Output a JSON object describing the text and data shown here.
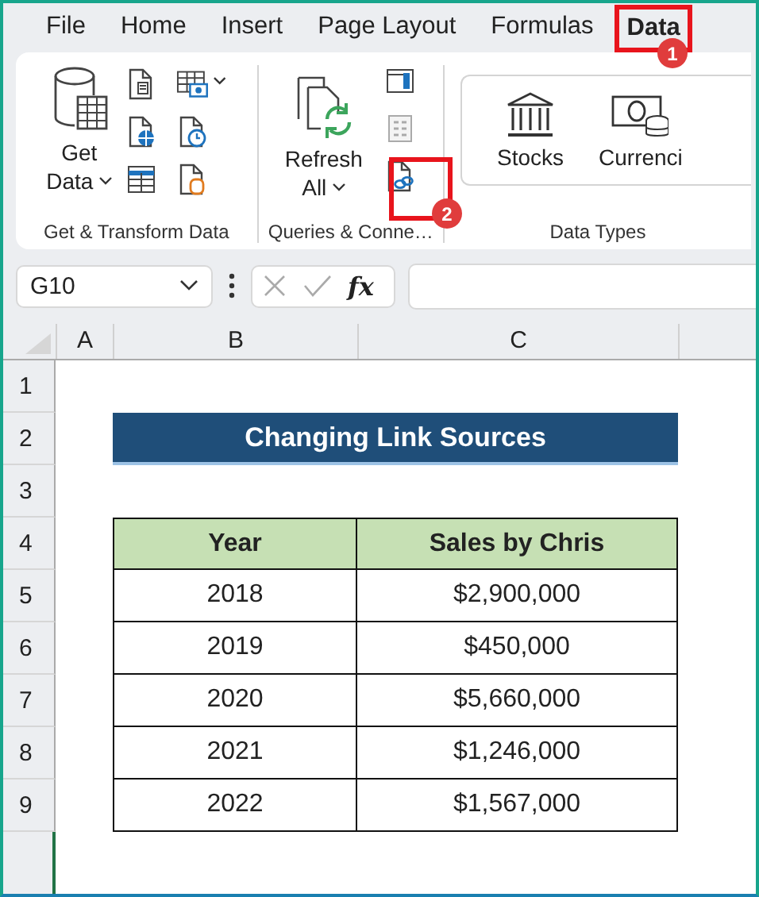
{
  "menu_tabs": [
    {
      "label": "File",
      "selected": false
    },
    {
      "label": "Home",
      "selected": false
    },
    {
      "label": "Insert",
      "selected": false
    },
    {
      "label": "Page Layout",
      "selected": false
    },
    {
      "label": "Formulas",
      "selected": false
    },
    {
      "label": "Data",
      "selected": true
    }
  ],
  "ribbon": {
    "groups": [
      {
        "label": "Get & Transform Data",
        "large_button": [
          "Get",
          "Data"
        ]
      },
      {
        "label": "Queries & Conne…",
        "large_button": [
          "Refresh",
          "All"
        ]
      },
      {
        "label": "Data Types",
        "type_buttons": [
          "Stocks",
          "Currenci"
        ]
      }
    ]
  },
  "callouts": [
    {
      "label": "1"
    },
    {
      "label": "2"
    }
  ],
  "name_box": {
    "value": "G10"
  },
  "formula_bar": {
    "fx": "fx"
  },
  "sheet": {
    "columns": [
      "A",
      "B",
      "C"
    ],
    "rows": [
      "1",
      "2",
      "3",
      "4",
      "5",
      "6",
      "7",
      "8",
      "9"
    ],
    "title": "Changing Link Sources",
    "table": {
      "columns": [
        "Year",
        "Sales by Chris"
      ],
      "rows": [
        [
          "2018",
          "$2,900,000"
        ],
        [
          "2019",
          "$450,000"
        ],
        [
          "2020",
          "$5,660,000"
        ],
        [
          "2021",
          "$1,246,000"
        ],
        [
          "2022",
          "$1,567,000"
        ]
      ]
    }
  }
}
